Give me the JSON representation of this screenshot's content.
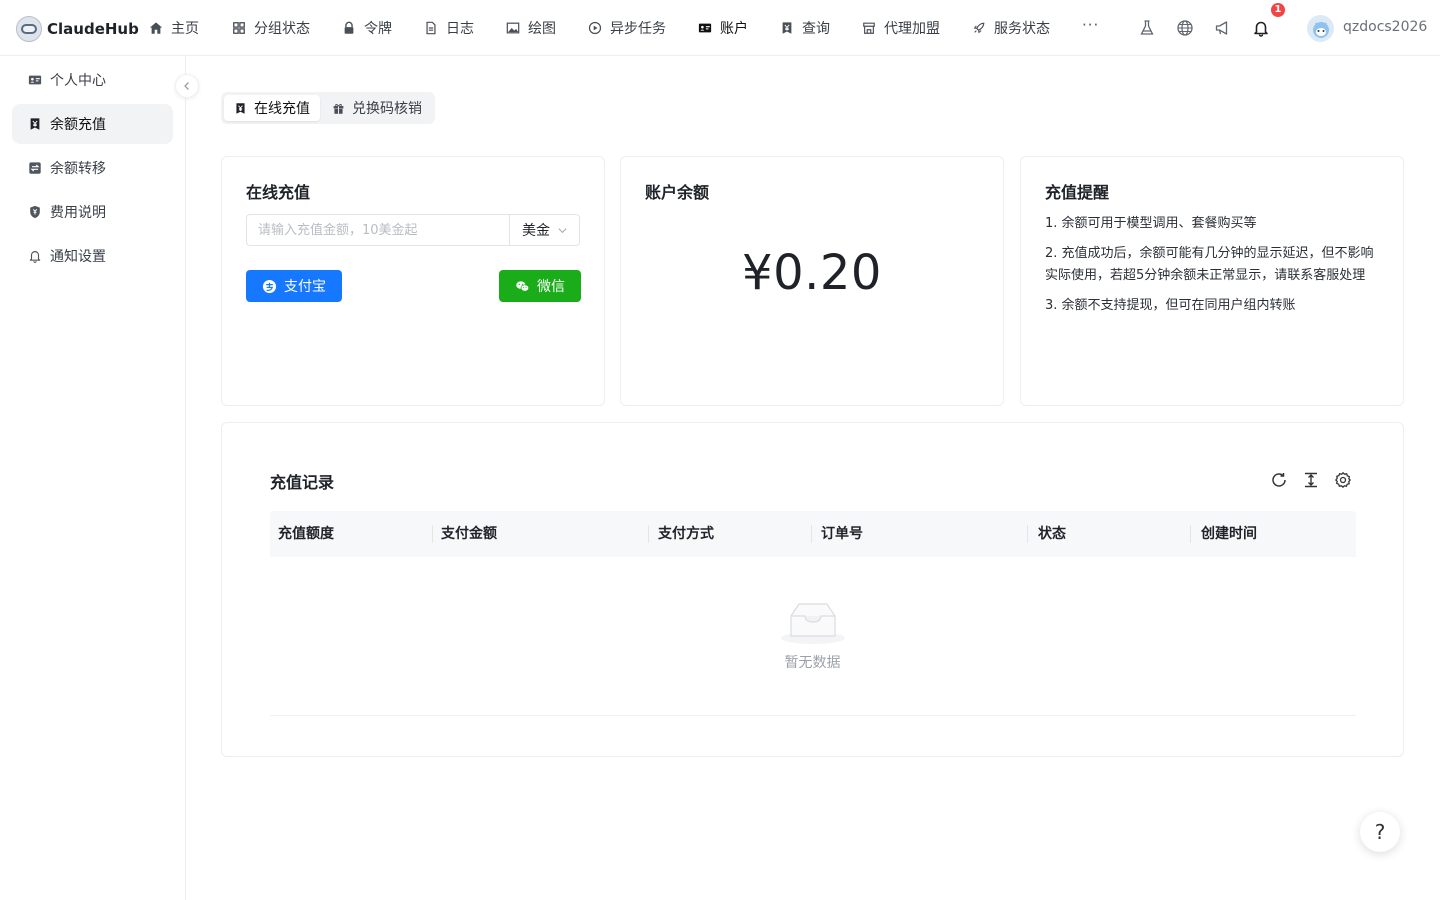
{
  "brand": {
    "name": "ClaudeHub"
  },
  "nav": {
    "items": [
      {
        "label": "主页",
        "icon": "home-icon"
      },
      {
        "label": "分组状态",
        "icon": "grid-icon"
      },
      {
        "label": "令牌",
        "icon": "lock-icon"
      },
      {
        "label": "日志",
        "icon": "document-icon"
      },
      {
        "label": "绘图",
        "icon": "image-icon"
      },
      {
        "label": "异步任务",
        "icon": "play-circle-icon"
      },
      {
        "label": "账户",
        "icon": "id-card-icon",
        "active": true
      },
      {
        "label": "查询",
        "icon": "yen-badge-icon"
      },
      {
        "label": "代理加盟",
        "icon": "store-icon"
      },
      {
        "label": "服务状态",
        "icon": "rocket-icon"
      }
    ],
    "more": "···",
    "notification_count": "1",
    "username": "qzdocs2026"
  },
  "sidebar": {
    "items": [
      {
        "label": "个人中心",
        "icon": "id-card-icon"
      },
      {
        "label": "余额充值",
        "icon": "yen-badge-icon",
        "active": true
      },
      {
        "label": "余额转移",
        "icon": "transfer-icon"
      },
      {
        "label": "费用说明",
        "icon": "shield-yen-icon"
      },
      {
        "label": "通知设置",
        "icon": "bell-icon"
      }
    ]
  },
  "tabs": [
    {
      "label": "在线充值",
      "icon": "yen-badge-icon",
      "active": true
    },
    {
      "label": "兑换码核销",
      "icon": "gift-icon"
    }
  ],
  "recharge": {
    "title": "在线充值",
    "amount_placeholder": "请输入充值金额，10美金起",
    "currency": "美金",
    "alipay_label": "支付宝",
    "wechat_label": "微信"
  },
  "balance": {
    "title": "账户余额",
    "value": "¥0.20"
  },
  "notice": {
    "title": "充值提醒",
    "items": [
      "1. 余额可用于模型调用、套餐购买等",
      "2. 充值成功后，余额可能有几分钟的显示延迟，但不影响实际使用，若超5分钟余额未正常显示，请联系客服处理",
      "3. 余额不支持提现，但可在同用户组内转账"
    ]
  },
  "records": {
    "title": "充值记录",
    "columns": [
      "充值额度",
      "支付金额",
      "支付方式",
      "订单号",
      "状态",
      "创建时间"
    ],
    "empty_text": "暂无数据"
  },
  "help": {
    "label": "?"
  },
  "colors": {
    "alipay": "#1677ff",
    "wechat": "#1aad19",
    "badge": "#f24444"
  }
}
